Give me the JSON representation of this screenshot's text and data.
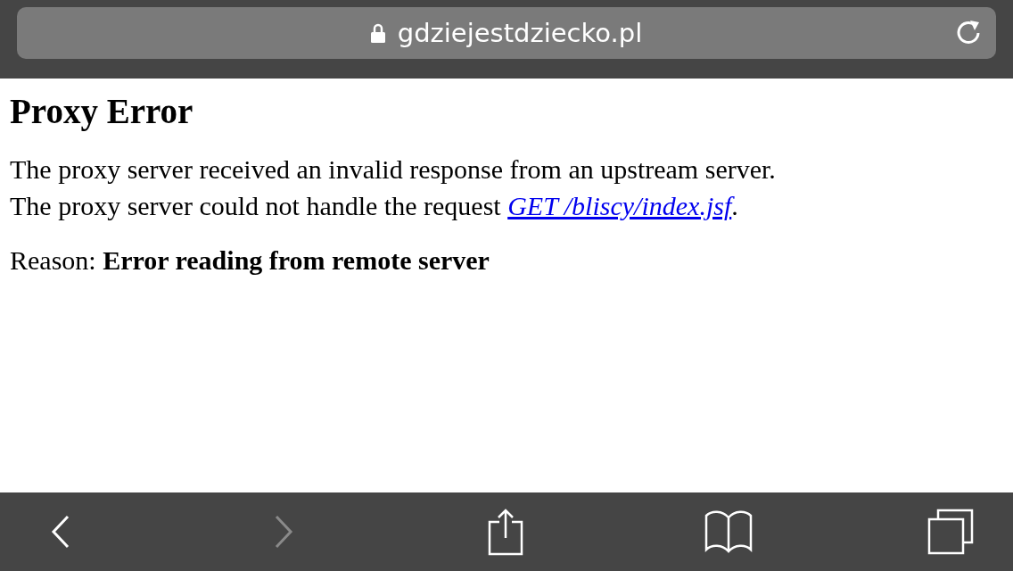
{
  "address_bar": {
    "url": "gdziejestdziecko.pl",
    "secure": true
  },
  "page": {
    "title": "Proxy Error",
    "line_1": "The proxy server received an invalid response from an upstream server.",
    "line_2_text": "The proxy server could not handle the request ",
    "line_2_link": "GET /bliscy/index.jsf",
    "line_2_end": ".",
    "reason": "Reason: **Error reading from remote server**"
  },
  "toolbar": [
    {
      "kind": "back",
      "disabled": false
    },
    {
      "kind": "forward",
      "disabled": true
    },
    {
      "kind": "share",
      "disabled": false
    },
    {
      "kind": "bookmarks",
      "disabled": false
    },
    {
      "kind": "tabs",
      "disabled": false
    }
  ]
}
